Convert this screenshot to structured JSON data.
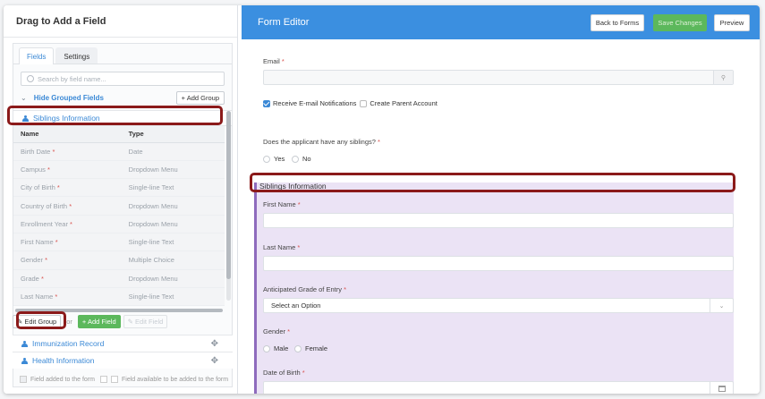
{
  "left_panel": {
    "title": "Drag to Add a Field",
    "tabs": [
      "Fields",
      "Settings"
    ],
    "search_placeholder": "Search by field name...",
    "hide_grouped": "Hide Grouped Fields",
    "add_group": "+ Add Group",
    "siblings_group": "Siblings Information",
    "table_headers": [
      "Name",
      "Type"
    ],
    "rows": [
      {
        "name": "Birth Date",
        "type": "Date"
      },
      {
        "name": "Campus",
        "type": "Dropdown Menu"
      },
      {
        "name": "City of Birth",
        "type": "Single-line Text"
      },
      {
        "name": "Country of Birth",
        "type": "Dropdown Menu"
      },
      {
        "name": "Enrollment Year",
        "type": "Dropdown Menu"
      },
      {
        "name": "First Name",
        "type": "Single-line Text"
      },
      {
        "name": "Gender",
        "type": "Multiple Choice"
      },
      {
        "name": "Grade",
        "type": "Dropdown Menu"
      },
      {
        "name": "Last Name",
        "type": "Single-line Text"
      }
    ],
    "required_mark": "*",
    "edit_group": "Edit Group",
    "or": "or",
    "add_field": "+ Add Field",
    "edit_field": "Edit Field",
    "groups": [
      "Immunization Record",
      "Health Information"
    ],
    "legend_added": "Field added to the form",
    "legend_available": "Field available to be added to the form"
  },
  "right_panel": {
    "title": "Form Editor",
    "back_button": "Back to Forms",
    "save_button": "Save Changes",
    "preview_button": "Preview",
    "email_label": "Email",
    "receive_notifications": "Receive E-mail Notifications",
    "create_parent": "Create Parent Account",
    "siblings_question": "Does the applicant have any siblings?",
    "yes": "Yes",
    "no": "No",
    "siblings_section": "Siblings Information",
    "first_name": "First Name",
    "last_name": "Last Name",
    "grade_label": "Anticipated Grade of Entry",
    "select_option": "Select an Option",
    "gender_label": "Gender",
    "male": "Male",
    "female": "Female",
    "dob_label": "Date of Birth",
    "req": "*"
  }
}
